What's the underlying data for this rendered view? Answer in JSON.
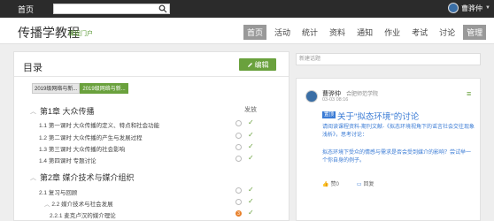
{
  "topbar": {
    "home": "首页",
    "search_placeholder": "",
    "username": "曹骅仲"
  },
  "header": {
    "course_title": "传播学教程",
    "course_portal": "课程门户",
    "nav": [
      "首页",
      "活动",
      "统计",
      "资料",
      "通知",
      "作业",
      "考试",
      "讨论",
      "管理"
    ]
  },
  "catalog": {
    "title": "目录",
    "edit_label": "编辑",
    "class_tabs": [
      "2019级网络与新...",
      "2019级网络与新..."
    ],
    "publish_label": "发放",
    "chapters": [
      {
        "label": "第1章 大众传播",
        "lessons": [
          "1.1  第一课时 大众传播的定义、特点和社会功能",
          "1.2  第二课时 大众传播的产生与发展过程",
          "1.3  第三课时 大众传播的社会影响",
          "1.4  第四课时 专题讨论"
        ]
      },
      {
        "label": "第2章 媒介技术与媒介组织",
        "lessons": [
          "2.1  复习与回顾",
          "2.2  媒介技术与社会发展",
          "2.2.1 麦克卢汉的媒介理论"
        ]
      }
    ],
    "orange_count": "3"
  },
  "discussion": {
    "new_topic_placeholder": "新建话题",
    "author": "曹骅仲",
    "school": "合肥师范学院",
    "time": "03-03 08:16",
    "badge": "置顶",
    "topic_title": "关于\"拟态环境\"的讨论",
    "body": "请阅读课程资料-期刊文献-《拟态环境视角下的谣言社会交往现象浅析》，思考讨论：",
    "question": "拟态环境下受众的情感与需求是否会受到媒介的影响？尝试举一个你自身的例子。",
    "like_label": "赞",
    "like_count": "0",
    "reply_label": "回复"
  }
}
